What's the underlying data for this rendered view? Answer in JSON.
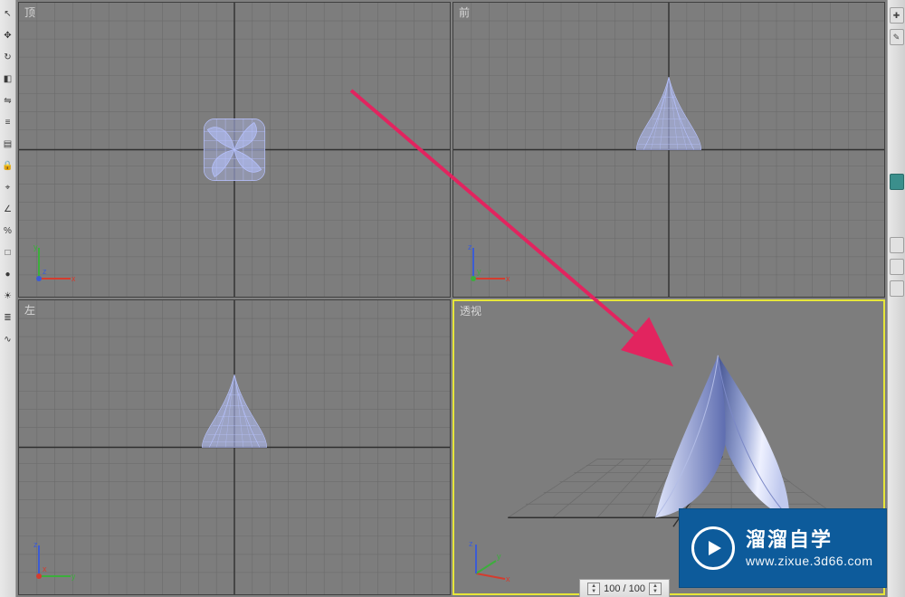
{
  "toolbar_left": {
    "items": [
      {
        "name": "select-icon",
        "glyph": "↖"
      },
      {
        "name": "move-icon",
        "glyph": "✥"
      },
      {
        "name": "rotate-icon",
        "glyph": "↻"
      },
      {
        "name": "scale-icon",
        "glyph": "◧"
      },
      {
        "name": "mirror-icon",
        "glyph": "⇋"
      },
      {
        "name": "align-icon",
        "glyph": "≡"
      },
      {
        "name": "layer-icon",
        "glyph": "▤"
      },
      {
        "name": "lock-icon",
        "glyph": "🔒"
      },
      {
        "name": "snap-icon",
        "glyph": "⌖"
      },
      {
        "name": "angle-snap-icon",
        "glyph": "∠"
      },
      {
        "name": "percent-snap-icon",
        "glyph": "%"
      },
      {
        "name": "named-sel-icon",
        "glyph": "□"
      },
      {
        "name": "material-icon",
        "glyph": "●"
      },
      {
        "name": "render-icon",
        "glyph": "☀"
      },
      {
        "name": "schematic-icon",
        "glyph": "≣"
      },
      {
        "name": "curve-editor-icon",
        "glyph": "∿"
      }
    ]
  },
  "right_panel": {
    "tabs": [
      {
        "name": "create-tab",
        "glyph": "✚"
      },
      {
        "name": "modify-tab",
        "glyph": "✎"
      }
    ]
  },
  "viewports": [
    {
      "key": "top",
      "label": "顶",
      "active": false,
      "mode": "wireframe",
      "axis": [
        "x",
        "y",
        "z"
      ]
    },
    {
      "key": "front",
      "label": "前",
      "active": false,
      "mode": "wireframe",
      "axis": [
        "x",
        "z",
        "y"
      ]
    },
    {
      "key": "left",
      "label": "左",
      "active": false,
      "mode": "wireframe",
      "axis": [
        "y",
        "z",
        "x"
      ]
    },
    {
      "key": "persp",
      "label": "透视",
      "active": true,
      "mode": "shaded",
      "axis": [
        "x",
        "y",
        "z"
      ]
    }
  ],
  "axis_colors": {
    "x": "#d43c2e",
    "y": "#3cae3c",
    "z": "#3c5cd4"
  },
  "object": {
    "mesh_color": "#b7c2ff",
    "shade_light": "#e6eaff",
    "shade_dark": "#4a5ba8"
  },
  "status": {
    "frame_display": "100 / 100"
  },
  "watermark": {
    "title": "溜溜自学",
    "url": "www.zixue.3d66.com",
    "icon_name": "play-icon"
  }
}
